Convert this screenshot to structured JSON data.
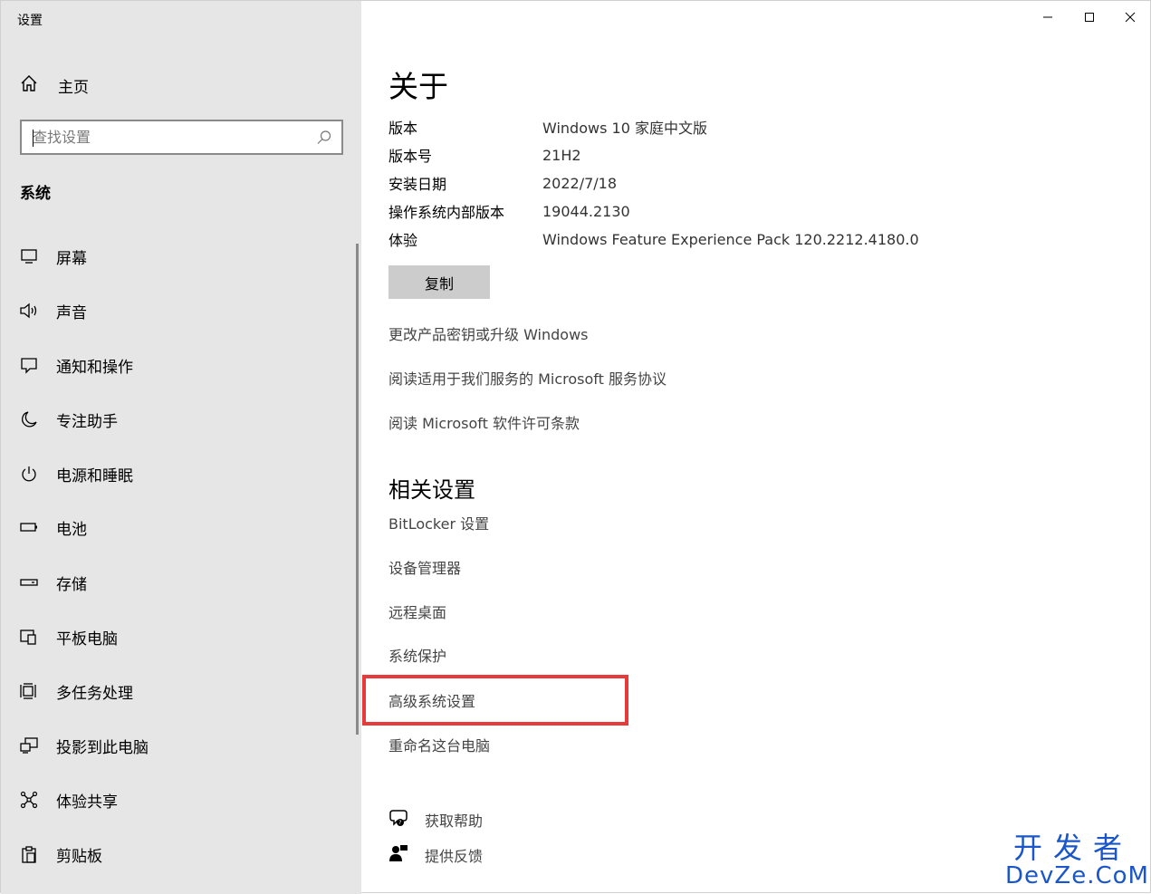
{
  "window": {
    "title": "设置"
  },
  "sidebar": {
    "home_label": "主页",
    "search_placeholder": "查找设置",
    "section_title": "系统",
    "items": [
      {
        "label": "屏幕",
        "icon": "monitor-icon"
      },
      {
        "label": "声音",
        "icon": "speaker-icon"
      },
      {
        "label": "通知和操作",
        "icon": "notification-icon"
      },
      {
        "label": "专注助手",
        "icon": "moon-icon"
      },
      {
        "label": "电源和睡眠",
        "icon": "power-icon"
      },
      {
        "label": "电池",
        "icon": "battery-icon"
      },
      {
        "label": "存储",
        "icon": "storage-icon"
      },
      {
        "label": "平板电脑",
        "icon": "tablet-icon"
      },
      {
        "label": "多任务处理",
        "icon": "multitask-icon"
      },
      {
        "label": "投影到此电脑",
        "icon": "project-icon"
      },
      {
        "label": "体验共享",
        "icon": "share-icon"
      },
      {
        "label": "剪贴板",
        "icon": "clipboard-icon"
      }
    ]
  },
  "about": {
    "title": "关于",
    "specs": [
      {
        "key": "版本",
        "value": "Windows 10 家庭中文版"
      },
      {
        "key": "版本号",
        "value": "21H2"
      },
      {
        "key": "安装日期",
        "value": "2022/7/18"
      },
      {
        "key": "操作系统内部版本",
        "value": "19044.2130"
      },
      {
        "key": "体验",
        "value": "Windows Feature Experience Pack 120.2212.4180.0"
      }
    ],
    "copy_label": "复制",
    "links": [
      "更改产品密钥或升级 Windows",
      "阅读适用于我们服务的 Microsoft 服务协议",
      "阅读 Microsoft 软件许可条款"
    ]
  },
  "related": {
    "title": "相关设置",
    "links": [
      "BitLocker 设置",
      "设备管理器",
      "远程桌面",
      "系统保护",
      "高级系统设置",
      "重命名这台电脑"
    ]
  },
  "help": {
    "get_help": "获取帮助",
    "feedback": "提供反馈"
  },
  "watermark": {
    "line1": "开发者",
    "line2": "DevZe.CoM"
  },
  "colors": {
    "sidebar_bg": "#e6e6e6",
    "highlight": "#e8393b",
    "watermark": "#1a56c9"
  }
}
